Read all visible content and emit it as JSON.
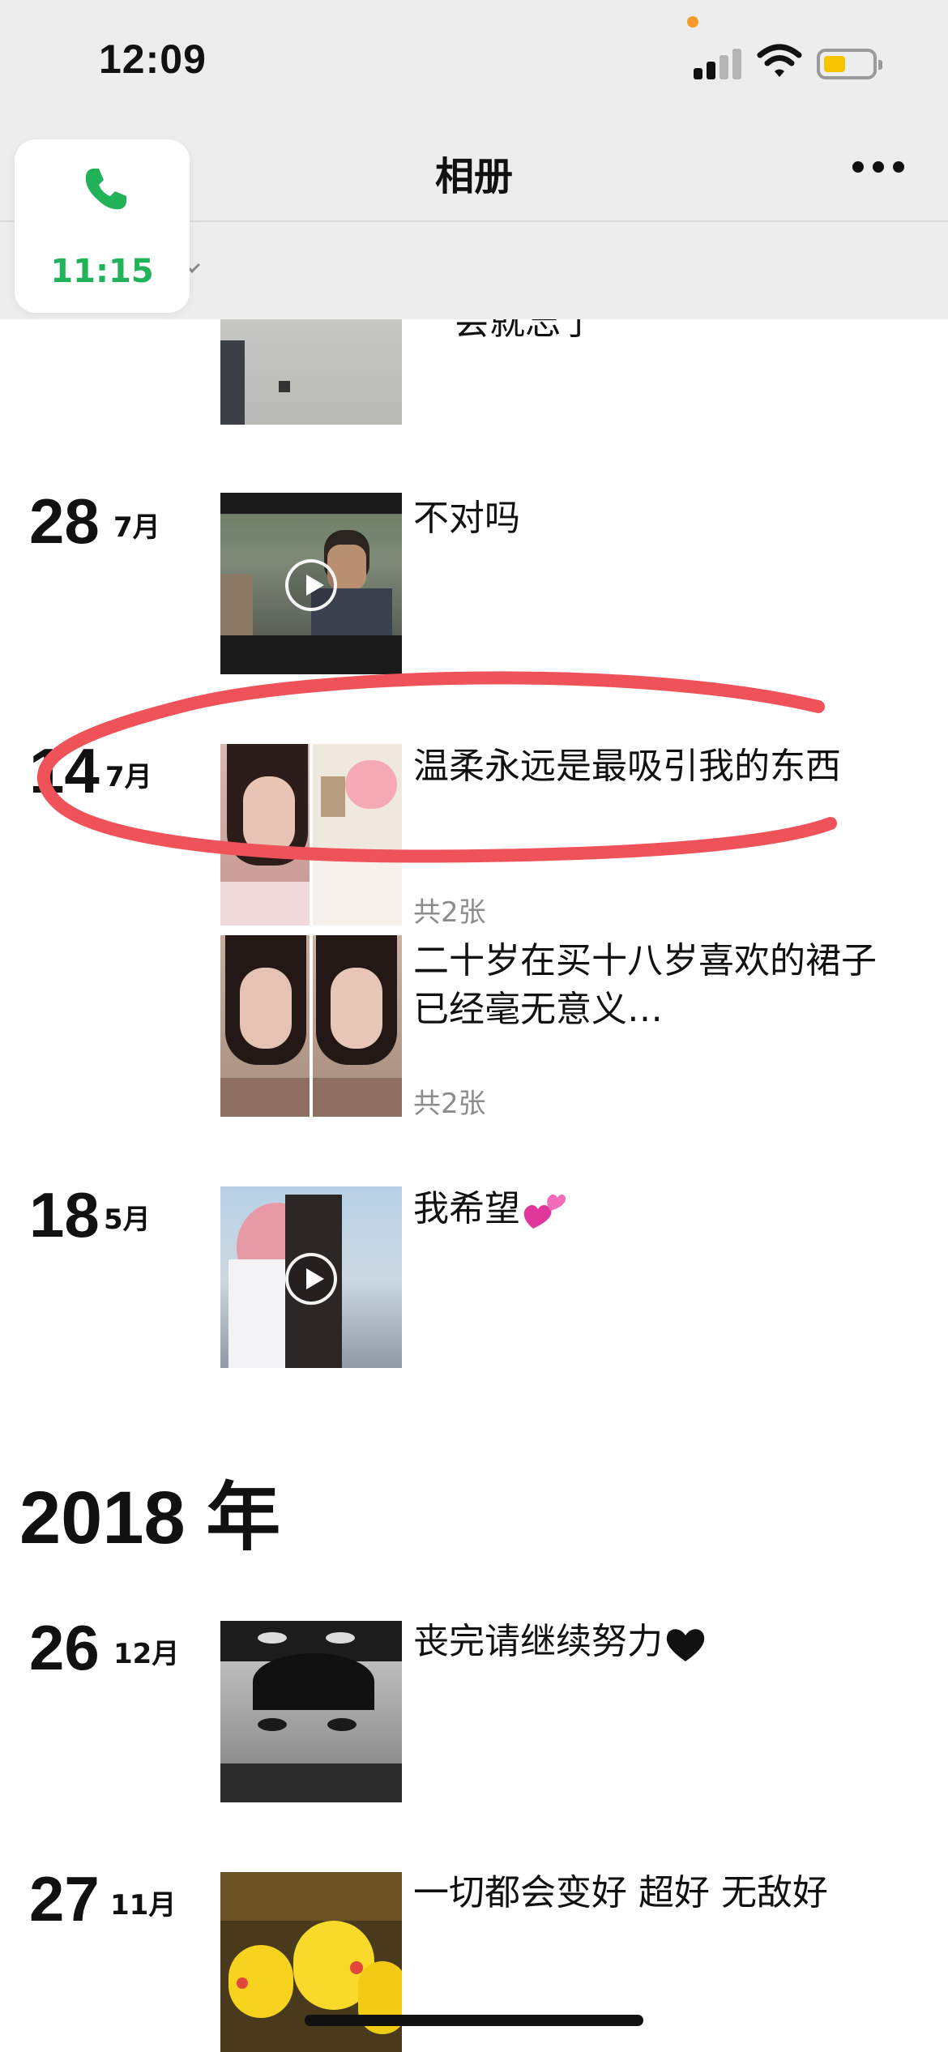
{
  "status_bar": {
    "time": "12:09"
  },
  "call_pill": {
    "duration": "11:15"
  },
  "nav": {
    "title": "相册"
  },
  "partial_top_text": "会就忘了",
  "posts": [
    {
      "day": "28",
      "month": "7月",
      "text": "不对吗",
      "media": "video"
    },
    {
      "day": "14",
      "month": "7月",
      "text": "温柔永远是最吸引我的东西",
      "count": "共2张",
      "media": "two-photos"
    },
    {
      "day": "",
      "month": "",
      "text": "二十岁在买十八岁喜欢的裙子已经毫无意义…",
      "count": "共2张",
      "media": "two-photos"
    },
    {
      "day": "18",
      "month": "5月",
      "text": "我希望",
      "emoji": "💕",
      "media": "video"
    }
  ],
  "year_header": "2018 年",
  "posts_2018": [
    {
      "day": "26",
      "month": "12月",
      "text": "丧完请继续努力",
      "emoji": "🖤",
      "media": "photo"
    },
    {
      "day": "27",
      "month": "11月",
      "text": "一切都会变好 超好 无敌好",
      "media": "photo"
    }
  ],
  "icons": {
    "more": "more-icon",
    "phone": "phone-icon",
    "play": "play-icon",
    "signal": "signal-icon",
    "wifi": "wifi-icon",
    "battery": "battery-icon"
  },
  "colors": {
    "call_green": "#22b35a",
    "annotation_red": "#f0525a",
    "battery_yellow": "#f7c500",
    "status_orange": "#f59a2b"
  }
}
